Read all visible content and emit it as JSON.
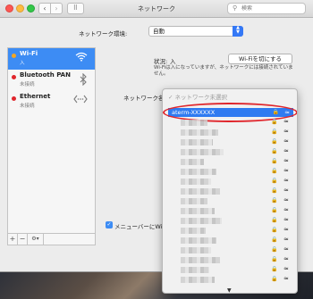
{
  "window": {
    "title": "ネットワーク",
    "search_placeholder": "検索",
    "nav_back": "‹",
    "nav_forward": "›",
    "grid": "⠿"
  },
  "location": {
    "label": "ネットワーク環境:",
    "value": "自動"
  },
  "sidebar": {
    "items": [
      {
        "name": "Wi-Fi",
        "status": "入",
        "dot_color": "#f5a623",
        "icon": "wifi-icon",
        "selected": true
      },
      {
        "name": "Bluetooth PAN",
        "status": "未接続",
        "dot_color": "#e0262c",
        "icon": "bluetooth-icon",
        "selected": false
      },
      {
        "name": "Ethernet",
        "status": "未接続",
        "dot_color": "#e0262c",
        "icon": "ethernet-icon",
        "selected": false
      }
    ],
    "toolbar": {
      "add": "+",
      "remove": "−",
      "actions": "⚙▾"
    }
  },
  "detail": {
    "status_label": "状況:",
    "status_value": "入",
    "wifi_off_button": "Wi-Fiを切にする",
    "description": "Wi-Fiは入になっていますが、ネットワークには接続されていません。",
    "network_name_label": "ネットワーク名",
    "menubar_label": "メニューバーにWi-",
    "menubar_checked": true
  },
  "dropdown": {
    "none_item": "✓ ネットワーク未選択",
    "selected_network": "aterm-XXXXXX",
    "highlight_color": "#e0262c",
    "more_indicator": "▼"
  }
}
